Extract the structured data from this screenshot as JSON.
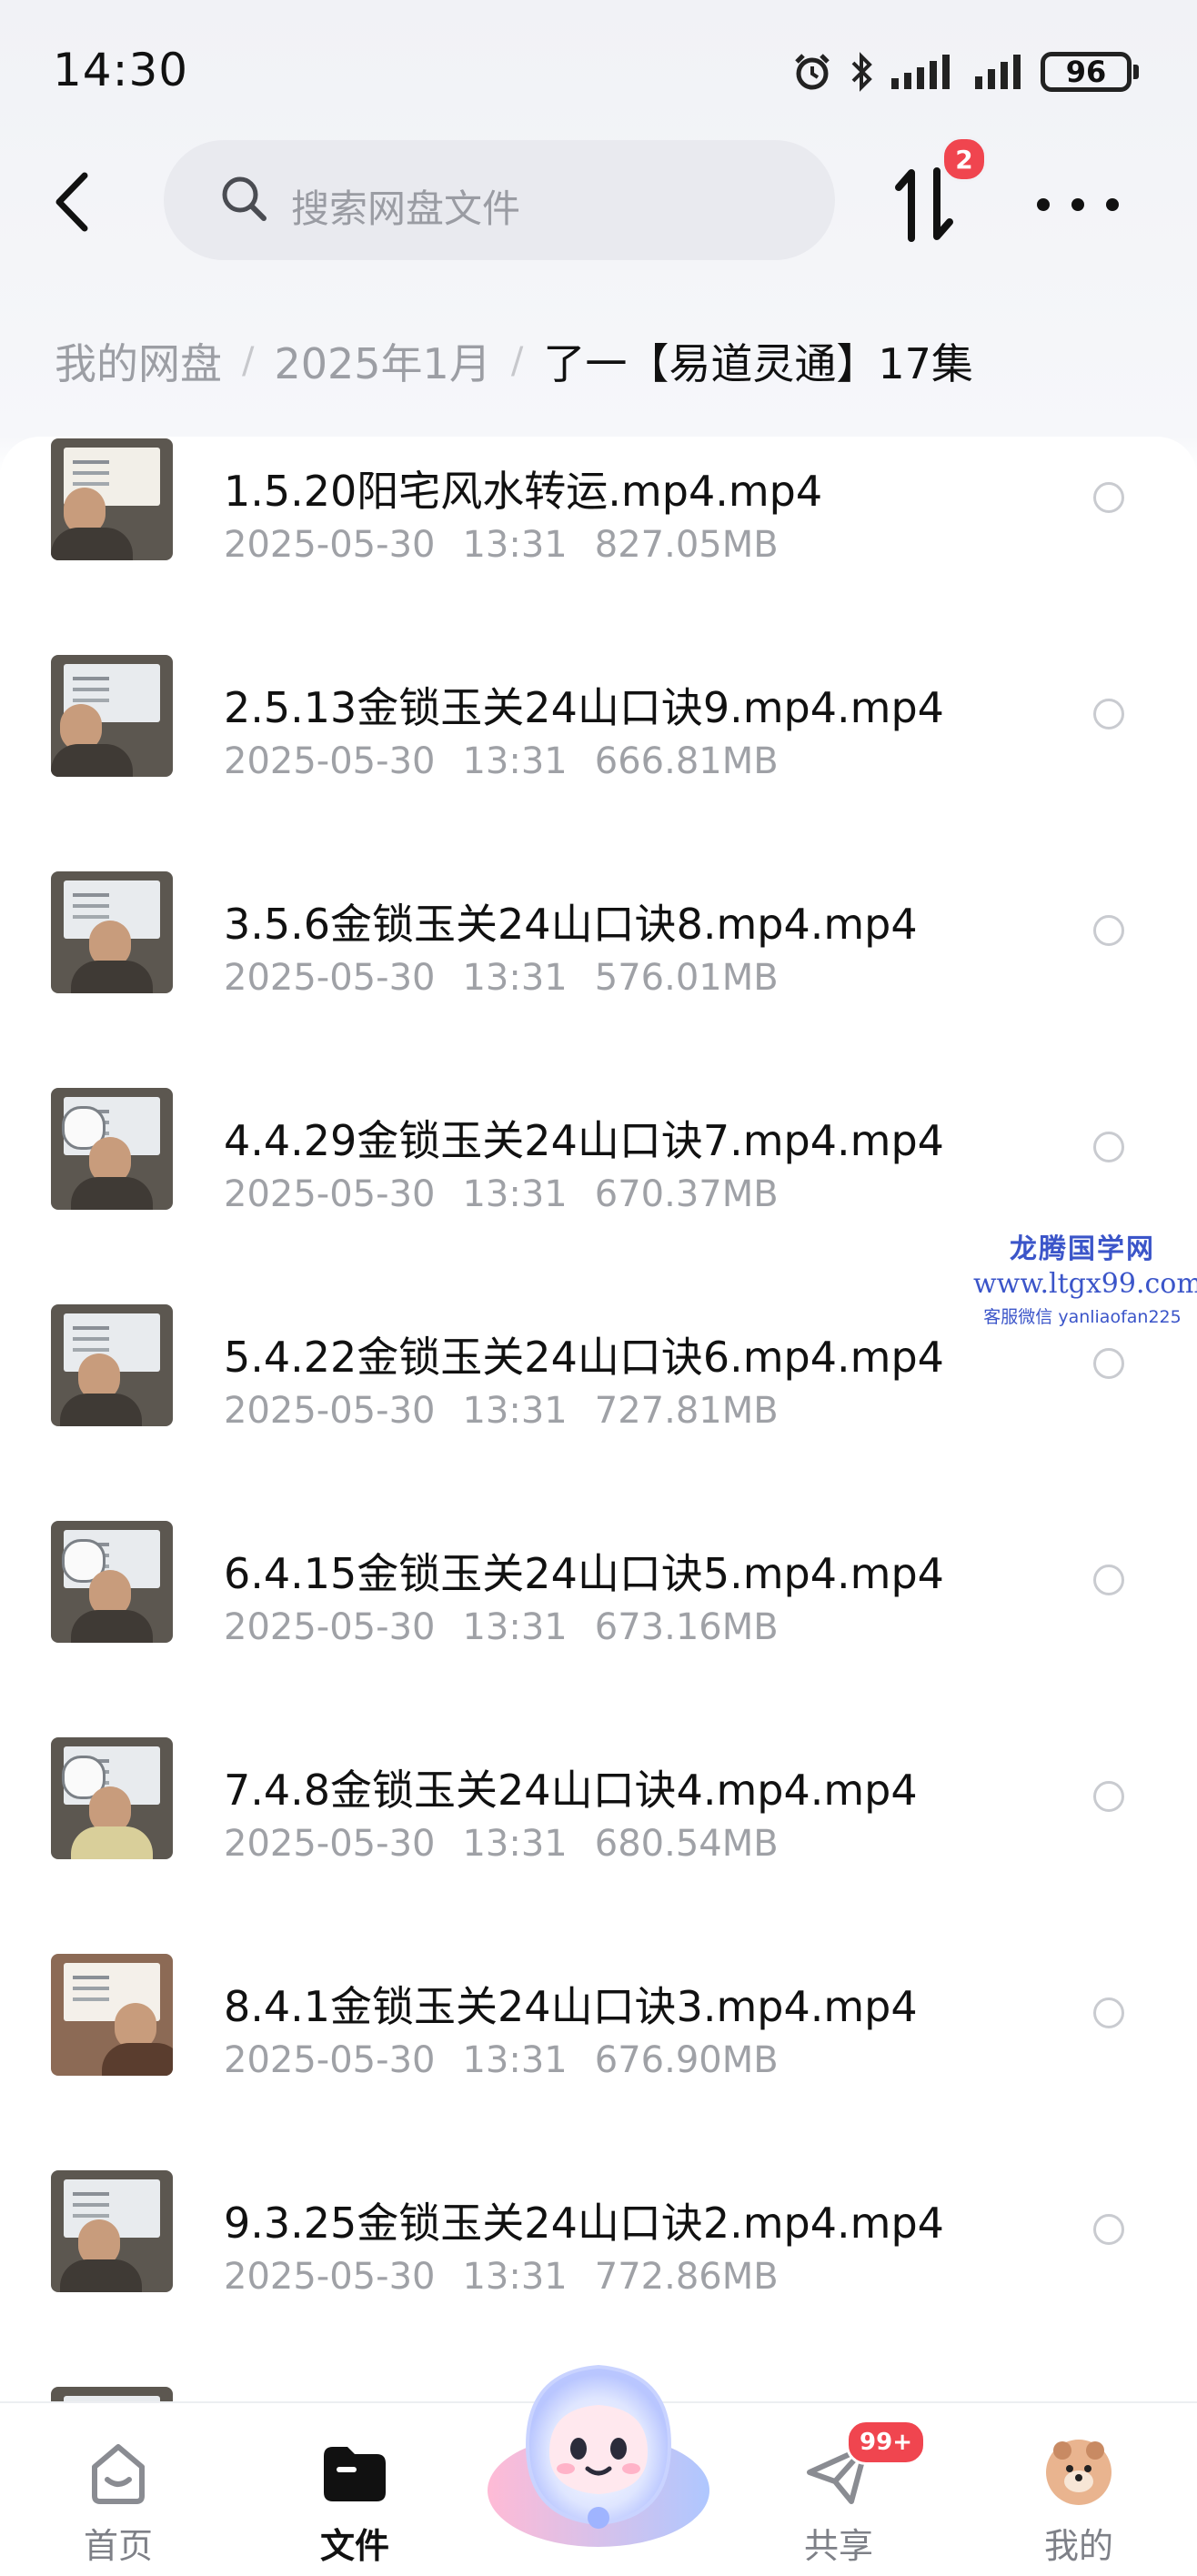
{
  "status_bar": {
    "time": "14:30",
    "battery": "96"
  },
  "header": {
    "search_placeholder": "搜索网盘文件",
    "transfer_badge": "2"
  },
  "breadcrumb": {
    "items": [
      "我的网盘",
      "2025年1月"
    ],
    "current": "了一【易道灵通】17集"
  },
  "files": [
    {
      "name": "1.5.20阳宅风水转运.mp4.mp4",
      "date": "2025-05-30",
      "time": "13:31",
      "size": "827.05MB"
    },
    {
      "name": "2.5.13金锁玉关24山口诀9.mp4.mp4",
      "date": "2025-05-30",
      "time": "13:31",
      "size": "666.81MB"
    },
    {
      "name": "3.5.6金锁玉关24山口诀8.mp4.mp4",
      "date": "2025-05-30",
      "time": "13:31",
      "size": "576.01MB"
    },
    {
      "name": "4.4.29金锁玉关24山口诀7.mp4.mp4",
      "date": "2025-05-30",
      "time": "13:31",
      "size": "670.37MB"
    },
    {
      "name": "5.4.22金锁玉关24山口诀6.mp4.mp4",
      "date": "2025-05-30",
      "time": "13:31",
      "size": "727.81MB"
    },
    {
      "name": "6.4.15金锁玉关24山口诀5.mp4.mp4",
      "date": "2025-05-30",
      "time": "13:31",
      "size": "673.16MB"
    },
    {
      "name": "7.4.8金锁玉关24山口诀4.mp4.mp4",
      "date": "2025-05-30",
      "time": "13:31",
      "size": "680.54MB"
    },
    {
      "name": "8.4.1金锁玉关24山口诀3.mp4.mp4",
      "date": "2025-05-30",
      "time": "13:31",
      "size": "676.90MB"
    },
    {
      "name": "9.3.25金锁玉关24山口诀2.mp4.mp4",
      "date": "2025-05-30",
      "time": "13:31",
      "size": "772.86MB"
    }
  ],
  "watermark": {
    "title": "龙腾国学网",
    "url": "www.ltgx99.com",
    "contact": "客服微信 yanliaofan225"
  },
  "bottom_nav": {
    "items": [
      {
        "label": "首页",
        "icon": "home-icon"
      },
      {
        "label": "文件",
        "icon": "folder-icon",
        "active": true
      },
      {
        "label": "共享",
        "icon": "share-icon",
        "badge": "99+"
      },
      {
        "label": "我的",
        "icon": "avatar-icon"
      }
    ]
  },
  "colors": {
    "accent_badge": "#f0454f",
    "text_primary": "#111111",
    "text_secondary": "#9fa1a6",
    "watermark": "#3b55c9"
  }
}
